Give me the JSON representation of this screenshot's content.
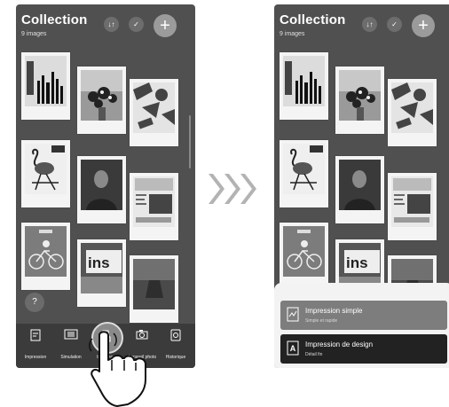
{
  "collection": {
    "title": "Collection",
    "count": "9 images",
    "sort_icon": "↓↑",
    "check_icon": "✓",
    "add_icon": "+"
  },
  "photos": [
    {
      "name": "photo-barcode-poster",
      "kind": "barcode"
    },
    {
      "name": "photo-bouquet",
      "kind": "flowers"
    },
    {
      "name": "photo-graphic-shapes",
      "kind": "graphic"
    },
    {
      "name": "photo-flamingo-chair",
      "kind": "flamingo"
    },
    {
      "name": "photo-man-portrait",
      "kind": "portrait"
    },
    {
      "name": "photo-magazine-page",
      "kind": "magazine"
    },
    {
      "name": "photo-bike-poster",
      "kind": "bike"
    },
    {
      "name": "photo-inst-sign",
      "kind": "inst"
    },
    {
      "name": "photo-room",
      "kind": "room"
    }
  ],
  "help": {
    "label": "?"
  },
  "tabs": [
    {
      "label": "Impression",
      "icon": "impression-icon"
    },
    {
      "label": "Simulation",
      "icon": "simulation-icon"
    },
    {
      "label": "Imprimer",
      "icon": "print-icon"
    },
    {
      "label": "Appareil photo",
      "icon": "camera-icon"
    },
    {
      "label": "Historique",
      "icon": "history-icon"
    }
  ],
  "print_sheet": {
    "options": [
      {
        "title": "Impression simple",
        "subtitle": "Simple et rapide",
        "icon": "simple-print-icon"
      },
      {
        "title": "Impression de design",
        "subtitle": "Détail fin",
        "icon": "design-print-icon"
      }
    ]
  },
  "colors": {
    "screen_bg": "#505050",
    "bottom_bar": "#3b3b3b",
    "sheet_bg": "#f3f3f3",
    "option_simple": "#7d7d7d",
    "option_design": "#222222",
    "chevron": "#b3b3b3"
  }
}
